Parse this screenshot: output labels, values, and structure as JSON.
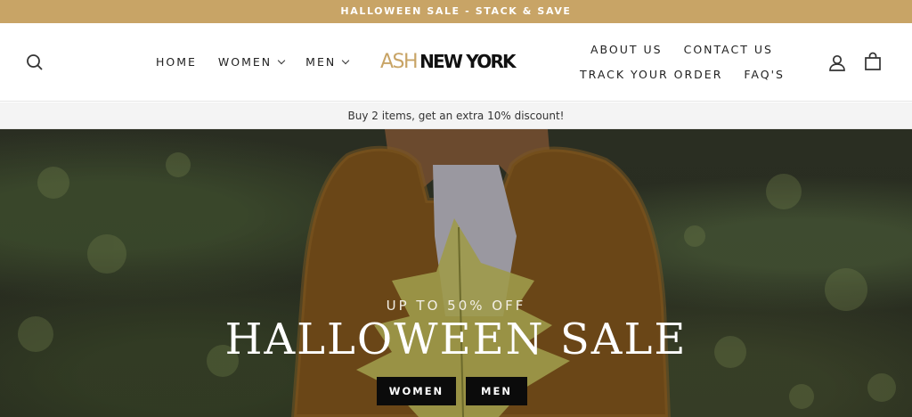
{
  "announcement": {
    "text": "HALLOWEEN SALE - STACK & SAVE"
  },
  "header": {
    "nav_left": [
      {
        "label": "HOME",
        "has_dropdown": false
      },
      {
        "label": "WOMEN",
        "has_dropdown": true
      },
      {
        "label": "MEN",
        "has_dropdown": true
      }
    ],
    "logo": {
      "part1": "ASH",
      "part2": "NEW YORK"
    },
    "nav_right_top": [
      "ABOUT US",
      "CONTACT US"
    ],
    "nav_right_bottom": [
      "TRACK YOUR ORDER",
      "FAQ'S"
    ],
    "icons": [
      "search-icon",
      "account-icon",
      "cart-icon"
    ]
  },
  "promo_bar": {
    "text": "Buy 2 items, get an extra 10% discount!"
  },
  "hero": {
    "kicker": "UP TO 50% OFF",
    "title": "HALLOWEEN SALE",
    "buttons": {
      "women": "WOMEN",
      "men": "MEN"
    }
  },
  "colors": {
    "accent": "#c8a466",
    "button_bg": "#0b0b0b",
    "promo_bg": "#f4f4f4"
  }
}
